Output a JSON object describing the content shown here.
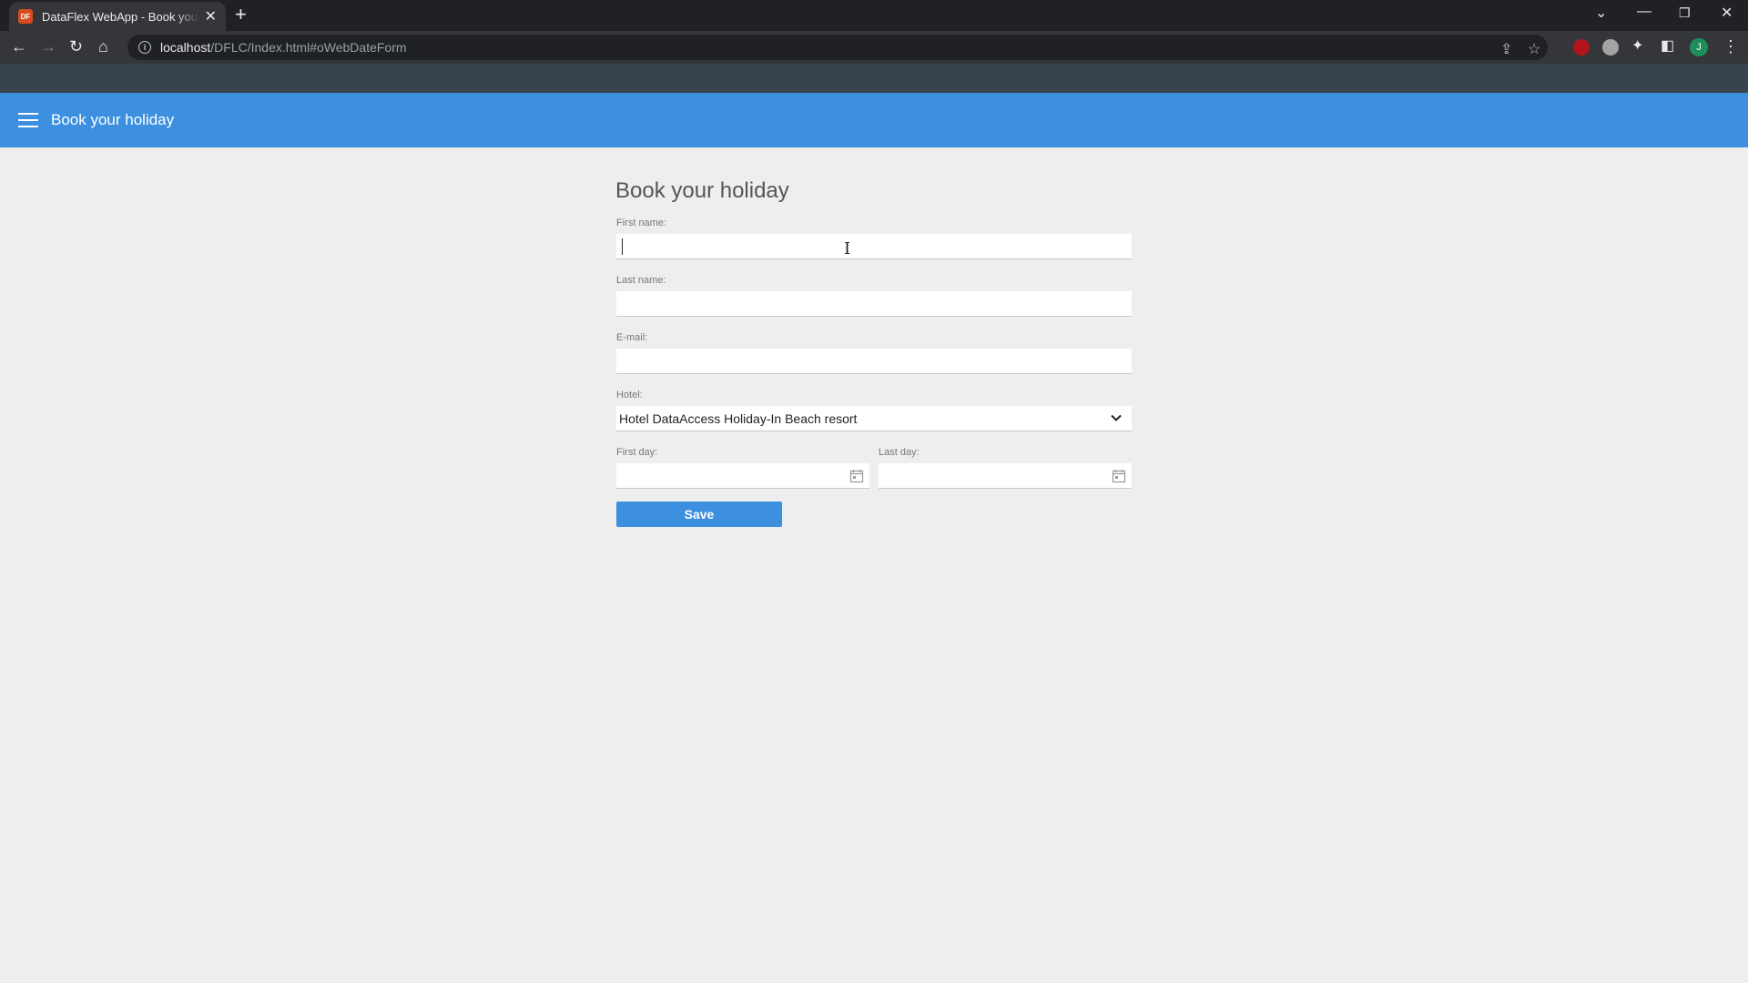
{
  "browser": {
    "tab_title": "DataFlex WebApp - Book your holiday",
    "favicon_text": "DF",
    "url_host": "localhost",
    "url_path": "/DFLC/Index.html#oWebDateForm",
    "profile_initial": "J"
  },
  "header": {
    "title": "Book your holiday"
  },
  "form": {
    "title": "Book your holiday",
    "first_name_label": "First name:",
    "first_name_value": "",
    "last_name_label": "Last name:",
    "last_name_value": "",
    "email_label": "E-mail:",
    "email_value": "",
    "hotel_label": "Hotel:",
    "hotel_value": "Hotel DataAccess Holiday-In Beach resort",
    "first_day_label": "First day:",
    "first_day_value": "",
    "last_day_label": "Last day:",
    "last_day_value": "",
    "save_label": "Save"
  },
  "colors": {
    "header_bg": "#3d8fe0",
    "button_bg": "#3d8fe0",
    "page_bg": "#eeeeee"
  }
}
